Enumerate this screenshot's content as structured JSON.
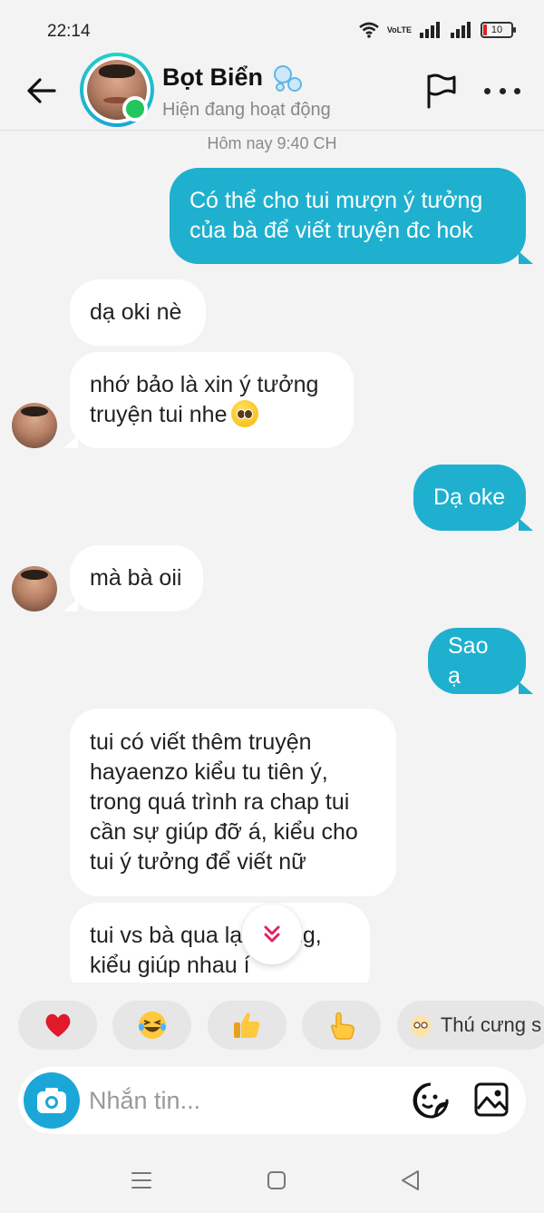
{
  "status_bar": {
    "time": "22:14",
    "network_label": "VoLTE",
    "battery": "10"
  },
  "header": {
    "contact_name": "Bọt Biển",
    "contact_status": "Hiện đang hoạt động",
    "icons": [
      "back-arrow-icon",
      "bubbles-icon",
      "flag-icon",
      "more-icon"
    ]
  },
  "conversation": {
    "date_label": "Hôm nay 9:40 CH",
    "messages": [
      {
        "direction": "out",
        "lines": [
          "Có thể cho tui mượn ý tưởng",
          "của bà để viết truyện đc hok"
        ]
      },
      {
        "direction": "in",
        "lines": [
          "dạ oki nè"
        ]
      },
      {
        "direction": "in",
        "lines": [
          "nhớ bảo là xin ý tưởng",
          "truyện tui nhe"
        ],
        "emoji": "pleading-face"
      },
      {
        "direction": "out",
        "lines": [
          "Dạ oke"
        ]
      },
      {
        "direction": "in",
        "lines": [
          "mà bà oii"
        ]
      },
      {
        "direction": "out",
        "lines": [
          "Sao ạ"
        ]
      },
      {
        "direction": "in",
        "lines": [
          "tui có viết thêm truyện",
          "hayaenzo kiểu tu tiên ý,",
          "trong quá trình ra chap tui",
          "cần sự giúp đỡ á, kiểu cho",
          "tui ý tưởng để viết nữ"
        ]
      },
      {
        "direction": "in",
        "lines": [
          "tui vs bà qua lại không,",
          "kiểu giúp nhau í"
        ],
        "partially_visible": true
      }
    ]
  },
  "reactions": [
    {
      "icon": "heart-icon",
      "label": ""
    },
    {
      "icon": "laughing-face-icon",
      "label": ""
    },
    {
      "icon": "thumbs-up-icon",
      "label": ""
    },
    {
      "icon": "pointing-hand-icon",
      "label": ""
    },
    {
      "icon": "pet-icon",
      "label": "Thú cưng s"
    }
  ],
  "composer": {
    "placeholder": "Nhắn tin..."
  },
  "colors": {
    "accent": "#1fb0cf",
    "online": "#22c55e",
    "background": "#f3f3f3"
  }
}
